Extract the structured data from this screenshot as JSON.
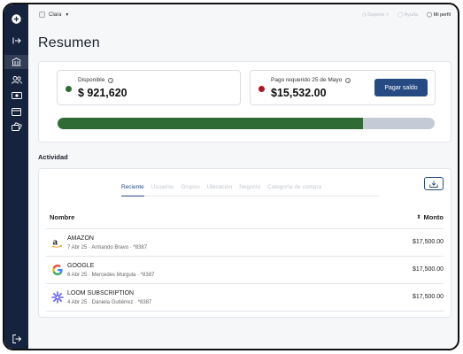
{
  "app": {
    "org_name": "Clara",
    "top_links": [
      "Soporte",
      "Ayuda",
      "Mi perfil"
    ]
  },
  "sidebar": {
    "icons": [
      "add-icon",
      "expand-icon",
      "bank-icon",
      "users-icon",
      "money-icon",
      "wallet-icon",
      "cards-icon",
      "logout-icon"
    ]
  },
  "page": {
    "title": "Resumen"
  },
  "summary": {
    "available_label": "Disponible",
    "available_value": "$ 921,620",
    "available_color": "#2e6b35",
    "due_label": "Pago requerido 25 de Mayo",
    "due_value": "$15,532.00",
    "due_color": "#b3121f",
    "pay_button": "Pagar saldo",
    "progress_fraction": 0.81
  },
  "activity": {
    "title": "Actividad",
    "tabs": [
      "Reciente",
      "Usuarios",
      "Grupos",
      "Ubicación",
      "Negocio",
      "Categoría de compra"
    ],
    "col_name": "Nombre",
    "col_amount": "Monto",
    "rows": [
      {
        "title": "AMAZON",
        "sub": "7 Abr 25 · Armando Bravo · *8387",
        "amount": "$17,500.00",
        "logo": "amazon-logo"
      },
      {
        "title": "GOOGLE",
        "sub": "6 Abr 25 · Mercedes Murgula · *8387",
        "amount": "$17,500.00",
        "logo": "google-logo"
      },
      {
        "title": "LOOM SUBSCRIPTION",
        "sub": "4 Abr 25 · Daniela Gutiérrez · *8387",
        "amount": "$17,500.00",
        "logo": "loom-logo"
      }
    ]
  }
}
